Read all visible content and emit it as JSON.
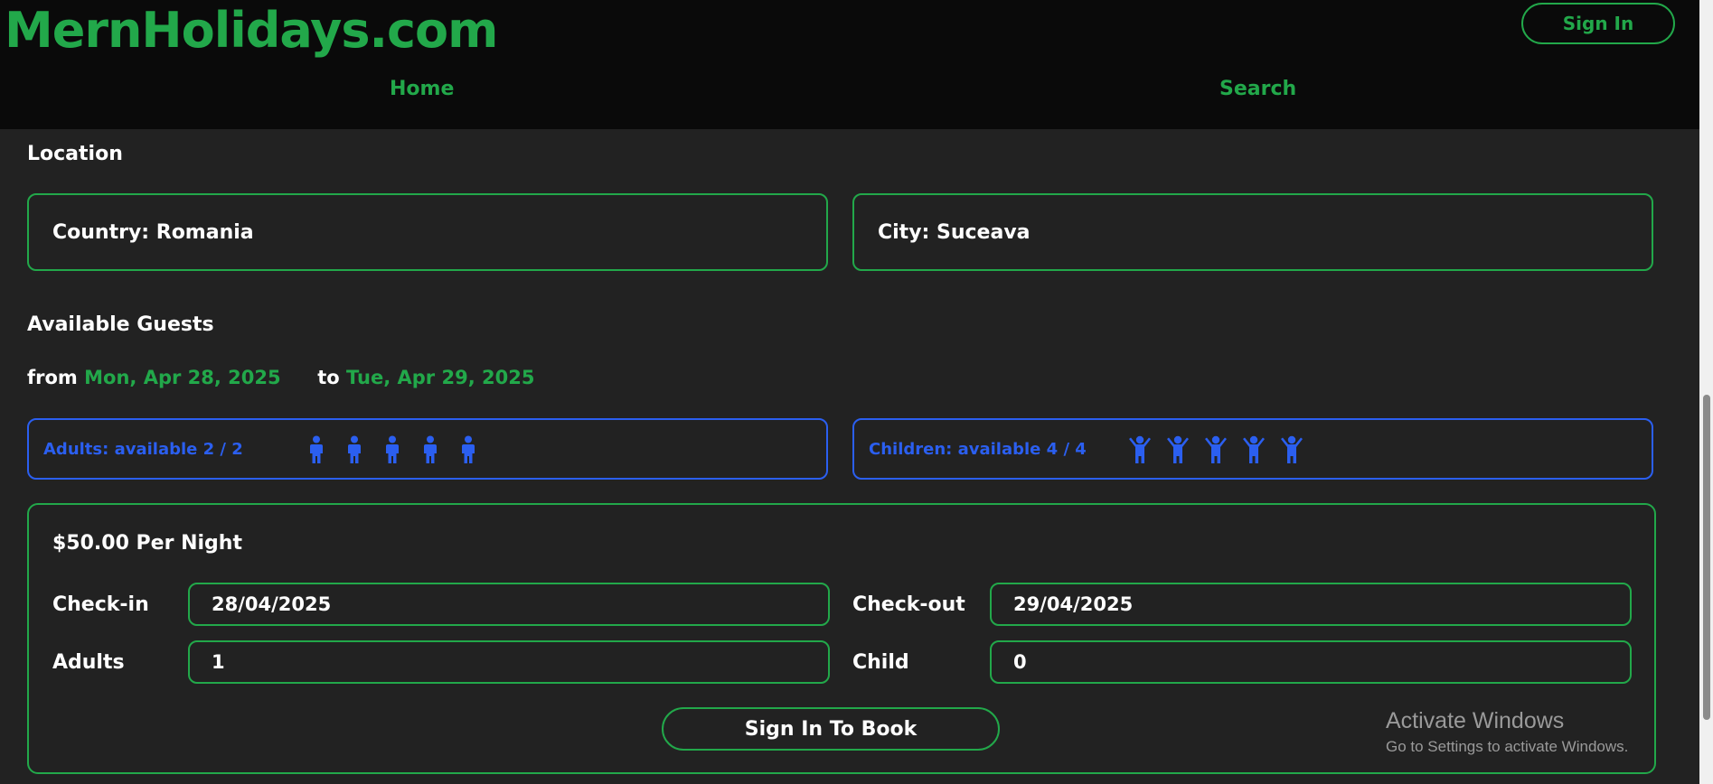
{
  "header": {
    "logo": "MernHolidays.com",
    "signin_label": "Sign In",
    "nav": [
      {
        "label": "Home"
      },
      {
        "label": "Search"
      }
    ]
  },
  "location": {
    "title": "Location",
    "country": "Country: Romania",
    "city": "City: Suceava"
  },
  "guests": {
    "title": "Available Guests",
    "from_label": "from",
    "from_date": "Mon, Apr 28, 2025",
    "to_label": "to",
    "to_date": "Tue, Apr 29, 2025",
    "adults_text": "Adults: available 2 / 2",
    "adults_icon_count": 5,
    "children_text": "Children: available 4 / 4",
    "children_icon_count": 5,
    "adult_icon": "person-icon",
    "child_icon": "child-icon",
    "accent_color": "#2b5ff0"
  },
  "booking": {
    "price": "$50.00 Per Night",
    "checkin_label": "Check-in",
    "checkin_value": "28/04/2025",
    "checkout_label": "Check-out",
    "checkout_value": "29/04/2025",
    "adults_label": "Adults",
    "adults_value": "1",
    "child_label": "Child",
    "child_value": "0",
    "book_button": "Sign In To Book"
  },
  "watermark": {
    "title": "Activate Windows",
    "subtitle": "Go to Settings to activate Windows."
  },
  "colors": {
    "brand_green": "#22a84a",
    "background": "#222222",
    "header_bg": "#0a0a0a"
  }
}
